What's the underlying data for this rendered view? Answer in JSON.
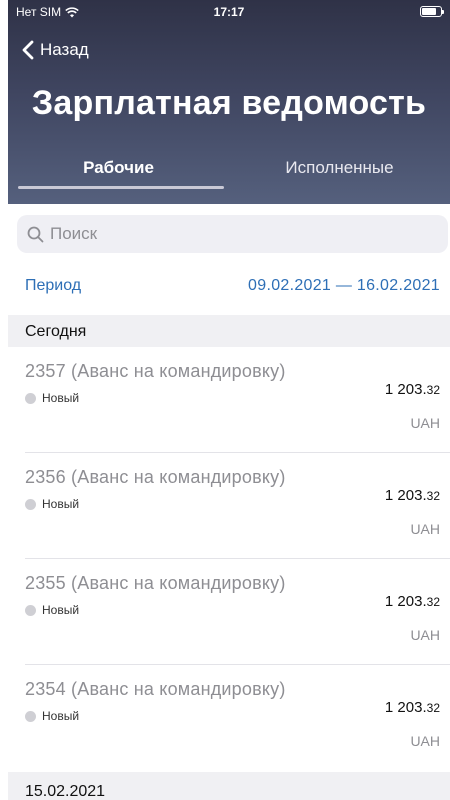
{
  "status_bar": {
    "carrier": "Нет SIM",
    "time": "17:17"
  },
  "nav": {
    "back_label": "Назад",
    "title": "Зарплатная ведомость"
  },
  "tabs": [
    {
      "label": "Рабочие"
    },
    {
      "label": "Исполненные"
    }
  ],
  "search": {
    "placeholder": "Поиск"
  },
  "period": {
    "label": "Период",
    "range": "09.02.2021 — 16.02.2021"
  },
  "sections": [
    {
      "title": "Сегодня"
    },
    {
      "title": "15.02.2021"
    }
  ],
  "items": [
    {
      "name": "2357 (Аванс на командировку)",
      "status": "Новый",
      "amount_main": "1 203.",
      "amount_cents": "32",
      "currency": "UAH"
    },
    {
      "name": "2356 (Аванс на командировку)",
      "status": "Новый",
      "amount_main": "1 203.",
      "amount_cents": "32",
      "currency": "UAH"
    },
    {
      "name": "2355 (Аванс на командировку)",
      "status": "Новый",
      "amount_main": "1 203.",
      "amount_cents": "32",
      "currency": "UAH"
    },
    {
      "name": "2354 (Аванс на командировку)",
      "status": "Новый",
      "amount_main": "1 203.",
      "amount_cents": "32",
      "currency": "UAH"
    }
  ],
  "colors": {
    "header_top": "#2f3247",
    "header_bottom": "#55607d",
    "accent": "#2e6fb6",
    "status_new_dot": "#cfcfd4"
  }
}
